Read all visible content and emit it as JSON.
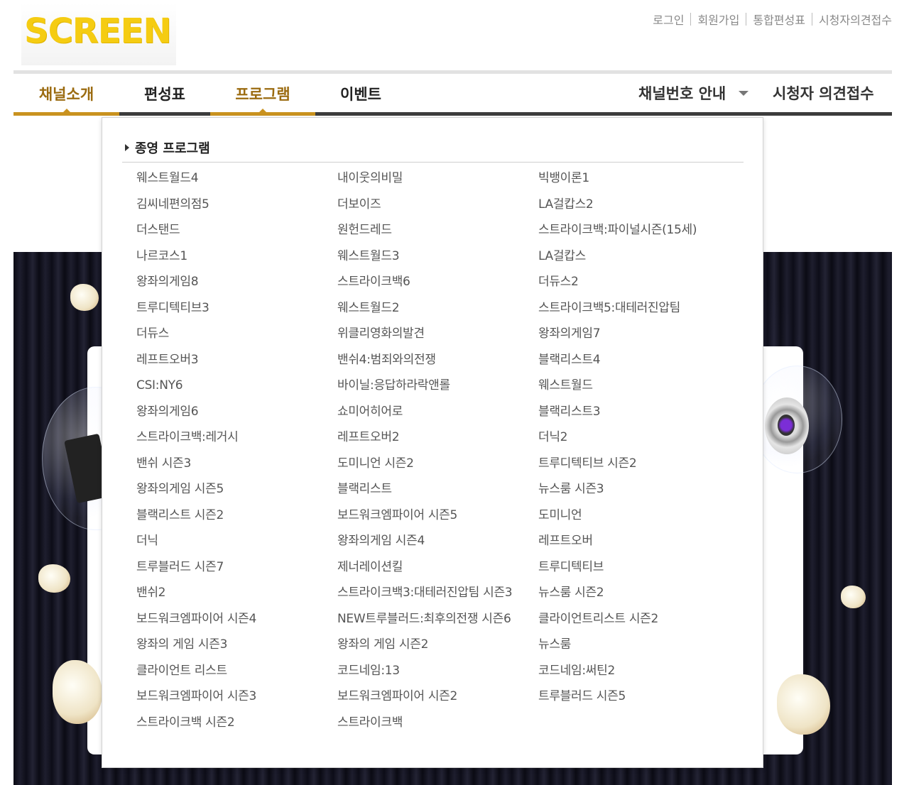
{
  "logo": {
    "text": "SCREEN"
  },
  "util_links": [
    "로그인",
    "회원가입",
    "통합편성표",
    "시청자의견접수"
  ],
  "gnb": {
    "items": [
      "채널소개",
      "편성표",
      "프로그램",
      "이벤트"
    ],
    "channel_guide": "채널번호 안내",
    "viewer_opinion": "시청자 의견접수"
  },
  "colors": {
    "accent": "#c9921f",
    "active_text": "#9b6b10",
    "logo": "#f5cc12",
    "bar": "#3c3c3c"
  },
  "menu": {
    "title": "종영 프로그램",
    "columns": [
      [
        "웨스트월드4",
        "김씨네편의점5",
        "더스탠드",
        "나르코스1",
        "왕좌의게임8",
        "트루디텍티브3",
        "더듀스",
        "레프트오버3",
        "CSI:NY6",
        "왕좌의게임6",
        "스트라이크백:레거시",
        "밴쉬 시즌3",
        "왕좌의게임 시즌5",
        "블랙리스트 시즌2",
        "더닉",
        "트루블러드 시즌7",
        "밴쉬2",
        "보드워크엠파이어 시즌4",
        "왕좌의 게임 시즌3",
        "클라이언트 리스트",
        "보드워크엠파이어 시즌3",
        "스트라이크백 시즌2"
      ],
      [
        "내이웃의비밀",
        "더보이즈",
        "원헌드레드",
        "웨스트월드3",
        "스트라이크백6",
        "웨스트월드2",
        "위클리영화의발견",
        "밴쉬4:범죄와의전쟁",
        "바이닐:응답하라락앤롤",
        "쇼미어히어로",
        "레프트오버2",
        "도미니언 시즌2",
        "블랙리스트",
        "보드워크엠파이어 시즌5",
        "왕좌의게임 시즌4",
        "제너레이션킬",
        "스트라이크백3:대테러진압팀 시즌3",
        "NEW트루블러드:최후의전쟁 시즌6",
        "왕좌의 게임 시즌2",
        "코드네임:13",
        "보드워크엠파이어 시즌2",
        "스트라이크백"
      ],
      [
        "빅뱅이론1",
        "LA걸캅스2",
        "스트라이크백:파이널시즌(15세)",
        "LA걸캅스",
        "더듀스2",
        "스트라이크백5:대테러진압팀",
        "왕좌의게임7",
        "블랙리스트4",
        "웨스트월드",
        "블랙리스트3",
        "더닉2",
        "트루디텍티브 시즌2",
        "뉴스룸 시즌3",
        "도미니언",
        "레프트오버",
        "트루디텍티브",
        "뉴스룸 시즌2",
        "클라이언트리스트 시즌2",
        "뉴스룸",
        "코드네임:써틴2",
        "트루블러드 시즌5"
      ]
    ]
  }
}
